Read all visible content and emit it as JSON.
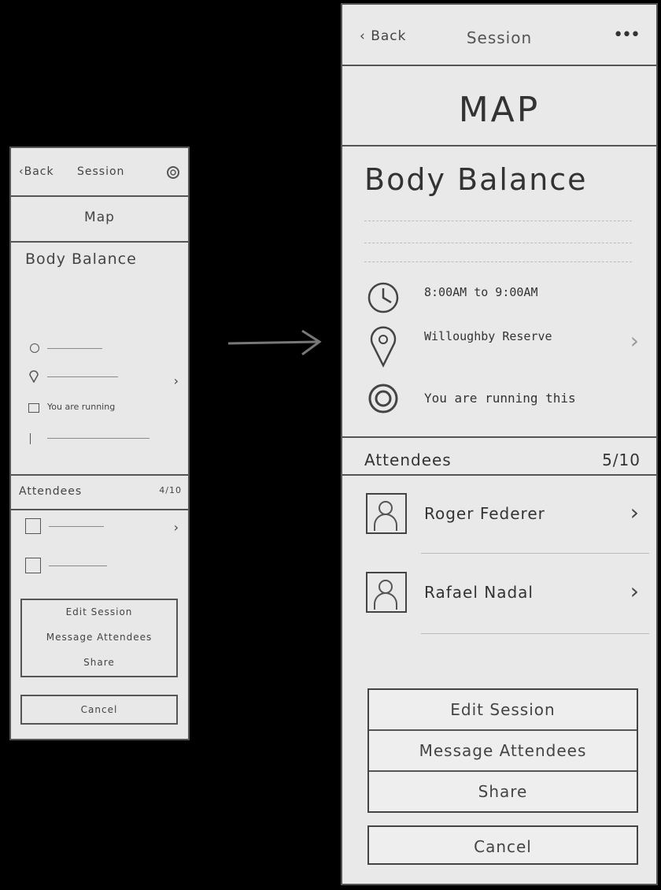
{
  "small_sketch": {
    "nav": {
      "back": "Back",
      "title": "Session"
    },
    "map_label": "Map",
    "title": "Body Balance",
    "rsvp_text": "You are running",
    "attendees_header": "Attendees",
    "attendees_count": "4/10",
    "actions": [
      "Edit Session",
      "Message Attendees",
      "Share"
    ],
    "cancel": "Cancel"
  },
  "large_sketch": {
    "nav": {
      "back": "Back",
      "title": "Session",
      "more": "•••"
    },
    "map_label": "MAP",
    "title": "Body Balance",
    "details": [
      {
        "icon": "clock-icon",
        "main": "8:00AM to 9:00AM",
        "sub": ""
      },
      {
        "icon": "location-pin-icon",
        "main": "Willoughby Reserve",
        "sub": ""
      },
      {
        "icon": "target-icon",
        "main": "You are running this"
      }
    ],
    "attendees_header": "Attendees",
    "attendees_count": "5/10",
    "attendees": [
      {
        "name": "Roger Federer"
      },
      {
        "name": "Rafael Nadal"
      }
    ],
    "actions": [
      "Edit Session",
      "Message Attendees",
      "Share"
    ],
    "cancel": "Cancel"
  }
}
